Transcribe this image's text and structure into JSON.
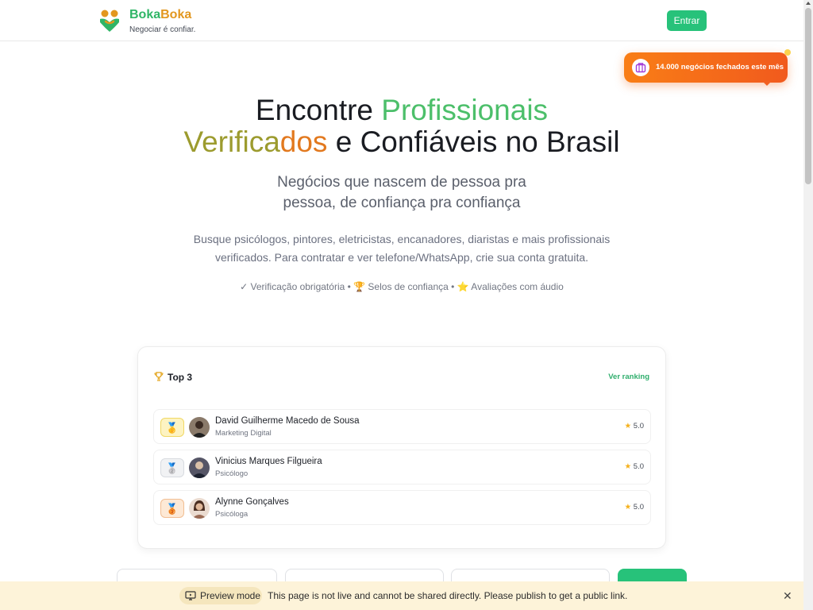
{
  "header": {
    "brand_part1": "Boka",
    "brand_part2": "Boka",
    "tagline": "Negociar é confiar.",
    "login_label": "Entrar"
  },
  "toast": {
    "text": "14.000 negócios fechados este mês",
    "icon": "briefcase-icon"
  },
  "hero": {
    "title_line1_a": "Encontre ",
    "title_line1_b": "Profissionais",
    "title_line2_a": "Verifica",
    "title_line2_b": "dos",
    "title_line2_c": " e Confiáveis no Brasil",
    "subtitle_line1": "Negócios que nascem de pessoa pra",
    "subtitle_line2": "pessoa, de confiança pra confiança",
    "desc_line1": "Busque psicólogos, pintores, eletricistas, encanadores, diaristas e mais profissionais",
    "desc_line2": "verificados. Para contratar e ver telefone/WhatsApp, crie sua conta gratuita.",
    "features": "✓ Verificação obrigatória • 🏆 Selos de confiança • ⭐ Avaliações com áudio"
  },
  "top3": {
    "title": "Top 3",
    "link_label": "Ver ranking",
    "items": [
      {
        "medal": "🥇",
        "name": "David Guilherme Macedo de Sousa",
        "role": "Marketing Digital",
        "rating": "5.0"
      },
      {
        "medal": "🥈",
        "name": "Vinicius Marques Filgueira",
        "role": "Psicólogo",
        "rating": "5.0"
      },
      {
        "medal": "🥉",
        "name": "Alynne Gonçalves",
        "role": "Psicóloga",
        "rating": "5.0"
      }
    ]
  },
  "preview_bar": {
    "label": "Preview mode",
    "message": "This page is not live and cannot be shared directly. Please publish to get a public link.",
    "close": "✕"
  },
  "colors": {
    "primary_green": "#27c27a",
    "accent_orange": "#f97e16",
    "brand_gold": "#e2971f"
  }
}
